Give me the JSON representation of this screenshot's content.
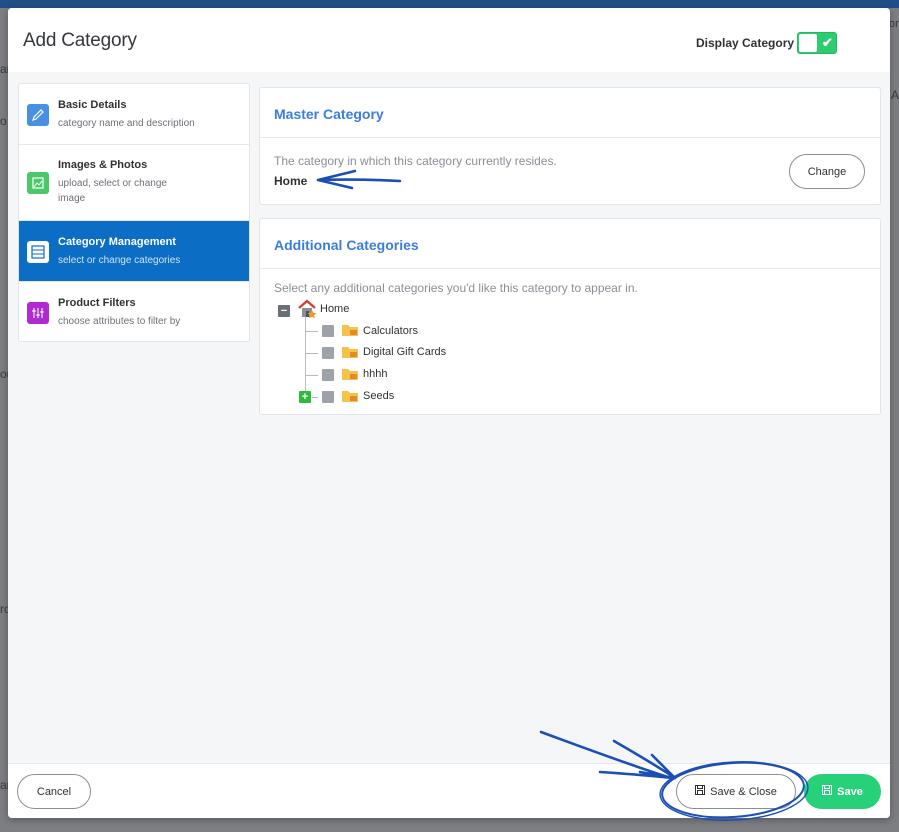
{
  "background": {
    "fragments": [
      "an",
      "o",
      "ou",
      "ro",
      "ar",
      "or",
      "A"
    ]
  },
  "modal": {
    "title": "Add Category",
    "display_toggle": {
      "label": "Display Category",
      "on": true
    }
  },
  "sidenav": {
    "items": [
      {
        "title": "Basic Details",
        "subtitle": "category name and description",
        "icon": "pencil-icon",
        "active": false
      },
      {
        "title": "Images & Photos",
        "subtitle": "upload, select or change image",
        "icon": "image-icon",
        "active": false
      },
      {
        "title": "Category Management",
        "subtitle": "select or change categories",
        "icon": "cabinet-icon",
        "active": true
      },
      {
        "title": "Product Filters",
        "subtitle": "choose attributes to filter by",
        "icon": "sliders-icon",
        "active": false
      }
    ]
  },
  "master_category": {
    "title": "Master Category",
    "description": "The category in which this category currently resides.",
    "value": "Home",
    "change_label": "Change"
  },
  "additional_categories": {
    "title": "Additional Categories",
    "description": "Select any additional categories you'd like this category to appear in.",
    "tree": {
      "root": "Home",
      "children": [
        "Calculators",
        "Digital Gift Cards",
        "hhhh",
        "Seeds"
      ]
    }
  },
  "footer": {
    "cancel_label": "Cancel",
    "save_close_label": "Save & Close",
    "save_label": "Save"
  },
  "colors": {
    "accent": "#0b6ec4",
    "title_blue": "#3b7ddd",
    "success": "#26d17a",
    "annotation": "#1a4fb5"
  }
}
